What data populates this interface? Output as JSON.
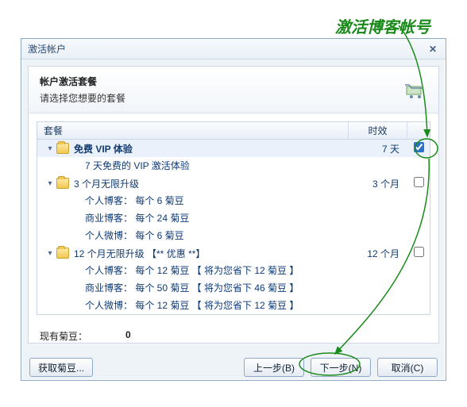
{
  "brand_text": "激活博客帐号",
  "dialog": {
    "title": "激活帐户",
    "header_title": "帐户激活套餐",
    "header_subtitle": "请选择您想要的套餐"
  },
  "columns": {
    "name": "套餐",
    "duration": "时效"
  },
  "plans": [
    {
      "name": "免费 VIP 体验",
      "duration": "7 天",
      "checked": true,
      "details": [
        "7 天免费的 VIP 激活体验"
      ]
    },
    {
      "name": "3 个月无限升级",
      "duration": "3 个月",
      "checked": false,
      "details": [
        "个人博客： 每个 6 菊豆",
        "商业博客： 每个 24 菊豆",
        "个人微博： 每个 6 菊豆"
      ]
    },
    {
      "name": "12 个月无限升级 【** 优惠 **】",
      "duration": "12 个月",
      "checked": false,
      "details": [
        "个人博客： 每个 12 菊豆 【 将为您省下 12 菊豆 】",
        "商业博客： 每个 50 菊豆 【 将为您省下 46 菊豆 】",
        "个人微博： 每个 12 菊豆 【 将为您省下 12 菊豆 】"
      ]
    }
  ],
  "balance": {
    "label": "现有菊豆：",
    "value": "0"
  },
  "buttons": {
    "get_beans": "获取菊豆...",
    "back": "上一步(B)",
    "next": "下一步(N)",
    "cancel": "取消(C)"
  },
  "annotation_color": "#1a8b1a"
}
